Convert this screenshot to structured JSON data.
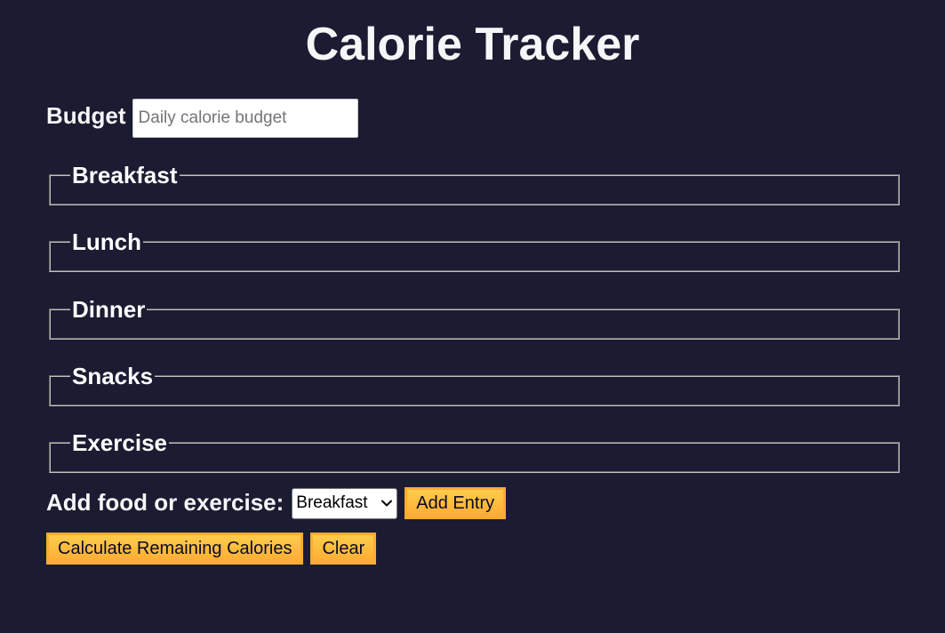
{
  "page": {
    "title": "Calorie Tracker"
  },
  "budget": {
    "label": "Budget",
    "placeholder": "Daily calorie budget"
  },
  "sections": {
    "breakfast": "Breakfast",
    "lunch": "Lunch",
    "dinner": "Dinner",
    "snacks": "Snacks",
    "exercise": "Exercise"
  },
  "add_entry": {
    "label": "Add food or exercise:",
    "selected_option": "Breakfast",
    "button_label": "Add Entry"
  },
  "actions": {
    "calculate_label": "Calculate Remaining Calories",
    "clear_label": "Clear"
  },
  "colors": {
    "background": "#1b1b32",
    "text": "#f5f6f7",
    "button": "#feac32"
  },
  "icons": {
    "select_chevron": "chevron-down-icon"
  }
}
